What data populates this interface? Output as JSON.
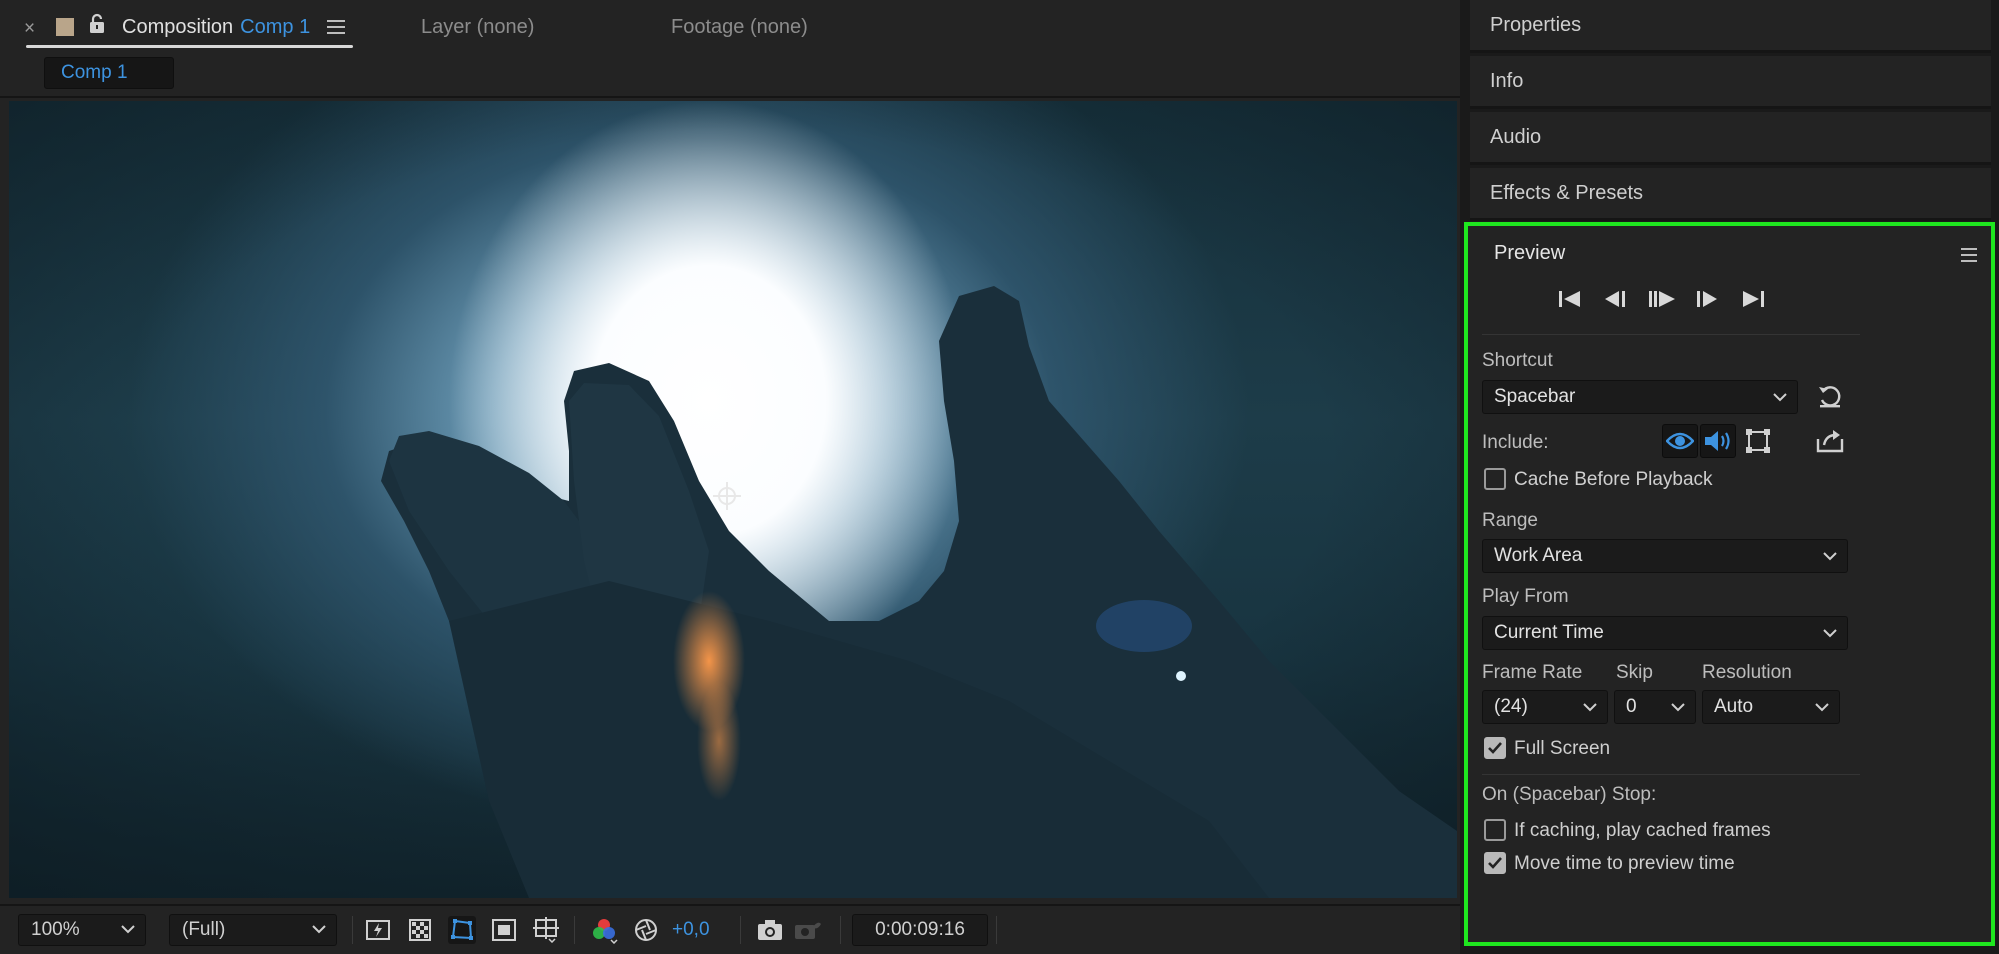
{
  "composition_panel": {
    "tabs": {
      "close_glyph": "×",
      "comp_kind": "Composition",
      "comp_name": "Comp 1",
      "layer": "Layer (none)",
      "footage": "Footage (none)"
    },
    "active_comp_chip": "Comp 1",
    "accent_color": "#3d93e0",
    "toolbar": {
      "magnification": "100%",
      "resolution": "(Full)",
      "exposure": "+0,0",
      "timecode": "0:00:09:16",
      "icons": [
        "fast-previews-icon",
        "transparency-grid-icon",
        "mask-path-icon",
        "region-of-interest-icon",
        "guides-grid-icon",
        "color-channels-icon",
        "reset-exposure-icon",
        "snapshot-camera-icon",
        "show-snapshot-icon"
      ]
    }
  },
  "right_panels": {
    "collapsed": [
      "Properties",
      "Info",
      "Audio",
      "Effects & Presets"
    ]
  },
  "preview": {
    "title": "Preview",
    "highlight_color": "#1fe61f",
    "transport_icons": [
      "first-frame-icon",
      "previous-frame-icon",
      "play-icon",
      "next-frame-icon",
      "last-frame-icon"
    ],
    "shortcut_label": "Shortcut",
    "shortcut_value": "Spacebar",
    "include_label": "Include:",
    "include_video": true,
    "include_audio": true,
    "include_overlays": false,
    "cache_before_playback": {
      "label": "Cache Before Playback",
      "checked": false
    },
    "range_label": "Range",
    "range_value": "Work Area",
    "play_from_label": "Play From",
    "play_from_value": "Current Time",
    "frame_rate_label": "Frame Rate",
    "frame_rate_value": "(24)",
    "skip_label": "Skip",
    "skip_value": "0",
    "resolution_label": "Resolution",
    "resolution_value": "Auto",
    "full_screen": {
      "label": "Full Screen",
      "checked": true
    },
    "on_stop_label": "On (Spacebar) Stop:",
    "play_cached": {
      "label": "If caching, play cached frames",
      "checked": false
    },
    "move_time": {
      "label": "Move time to preview time",
      "checked": true
    }
  }
}
